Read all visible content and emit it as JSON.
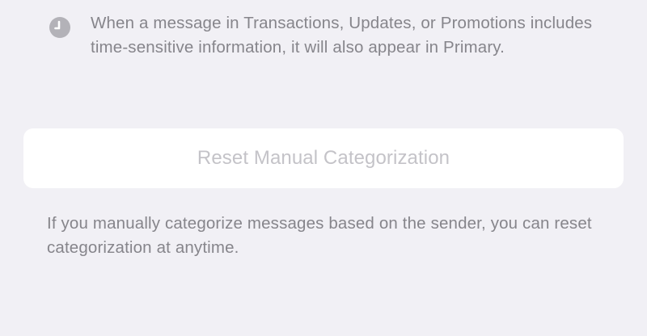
{
  "time_sensitive": {
    "icon": "clock-icon",
    "description": "When a message in Transactions, Updates, or Promotions includes time-sensitive information, it will also appear in Primary."
  },
  "reset": {
    "button_label": "Reset Manual Categorization",
    "footer": "If you manually categorize messages based on the sender, you can reset categorization at anytime."
  },
  "colors": {
    "background": "#f1f0f5",
    "secondary_text": "#86858b",
    "disabled_button_text": "#c4c3c8",
    "icon_fill": "#b3b2b8"
  }
}
